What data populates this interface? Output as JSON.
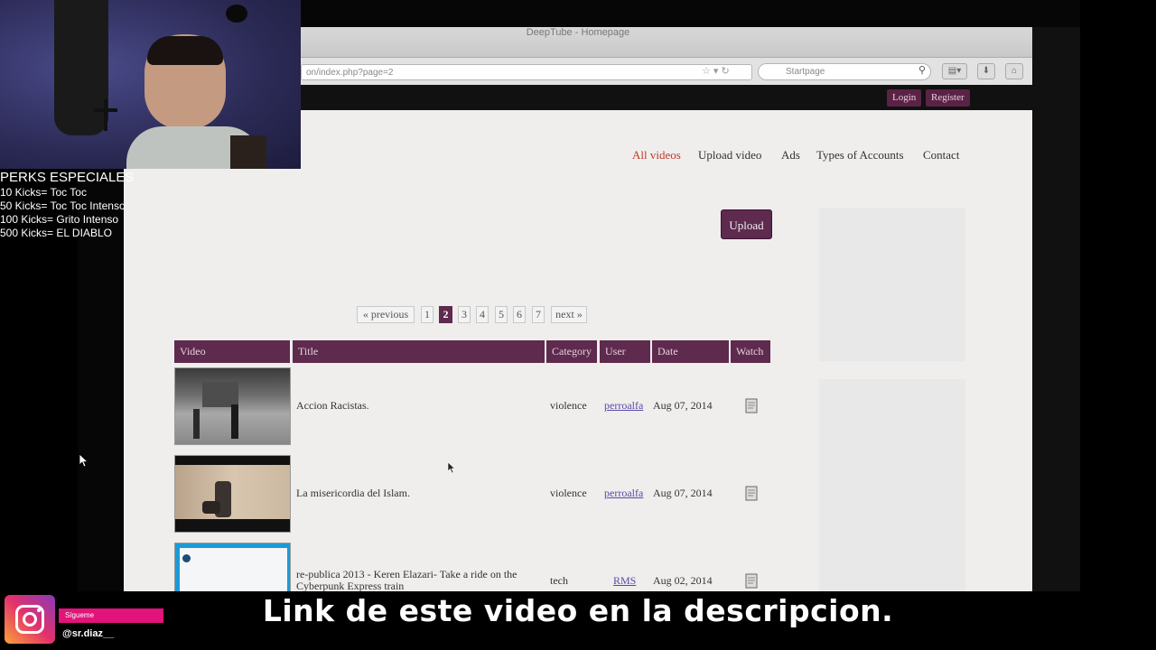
{
  "browser": {
    "window_title": "DeepTube - Homepage",
    "url": "on/index.php?page=2",
    "search_engine": "Startpage"
  },
  "site": {
    "auth": {
      "login": "Login",
      "register": "Register"
    },
    "nav": [
      "All videos",
      "Upload video",
      "Ads",
      "Types of Accounts",
      "Contact"
    ],
    "active_nav": "All videos",
    "upload_label": "Upload",
    "pagination": {
      "previous": "« previous",
      "pages": [
        "1",
        "2",
        "3",
        "4",
        "5",
        "6",
        "7"
      ],
      "current": "2",
      "next": "next »"
    },
    "table": {
      "headers": [
        "Video",
        "Title",
        "Category",
        "User",
        "Date",
        "Watch"
      ],
      "rows": [
        {
          "title": "Accion Racistas.",
          "category": "violence",
          "user": "perroalfa",
          "date": "Aug 07, 2014"
        },
        {
          "title": "La misericordia del Islam.",
          "category": "violence",
          "user": "perroalfa",
          "date": "Aug 07, 2014"
        },
        {
          "title": "re-publica 2013 - Keren Elazari- Take a ride on the Cyberpunk Express train",
          "category": "tech",
          "user": "RMS",
          "date": "Aug 02, 2014"
        }
      ]
    }
  },
  "overlay": {
    "perks_title": "PERKS ESPECIALES",
    "perks": [
      "10 Kicks= Toc Toc",
      "50 Kicks= Toc Toc Intenso",
      "100 Kicks= Grito Intenso",
      "500 Kicks= EL DIABLO"
    ],
    "subtitle": "Link de este video en la descripcion.",
    "social_tag": "Sígueme",
    "social_handle": "@sr.diaz__"
  },
  "colors": {
    "accent": "#5e2a4e",
    "active_nav": "#c0392b",
    "instagram_tag": "#e0147a"
  }
}
